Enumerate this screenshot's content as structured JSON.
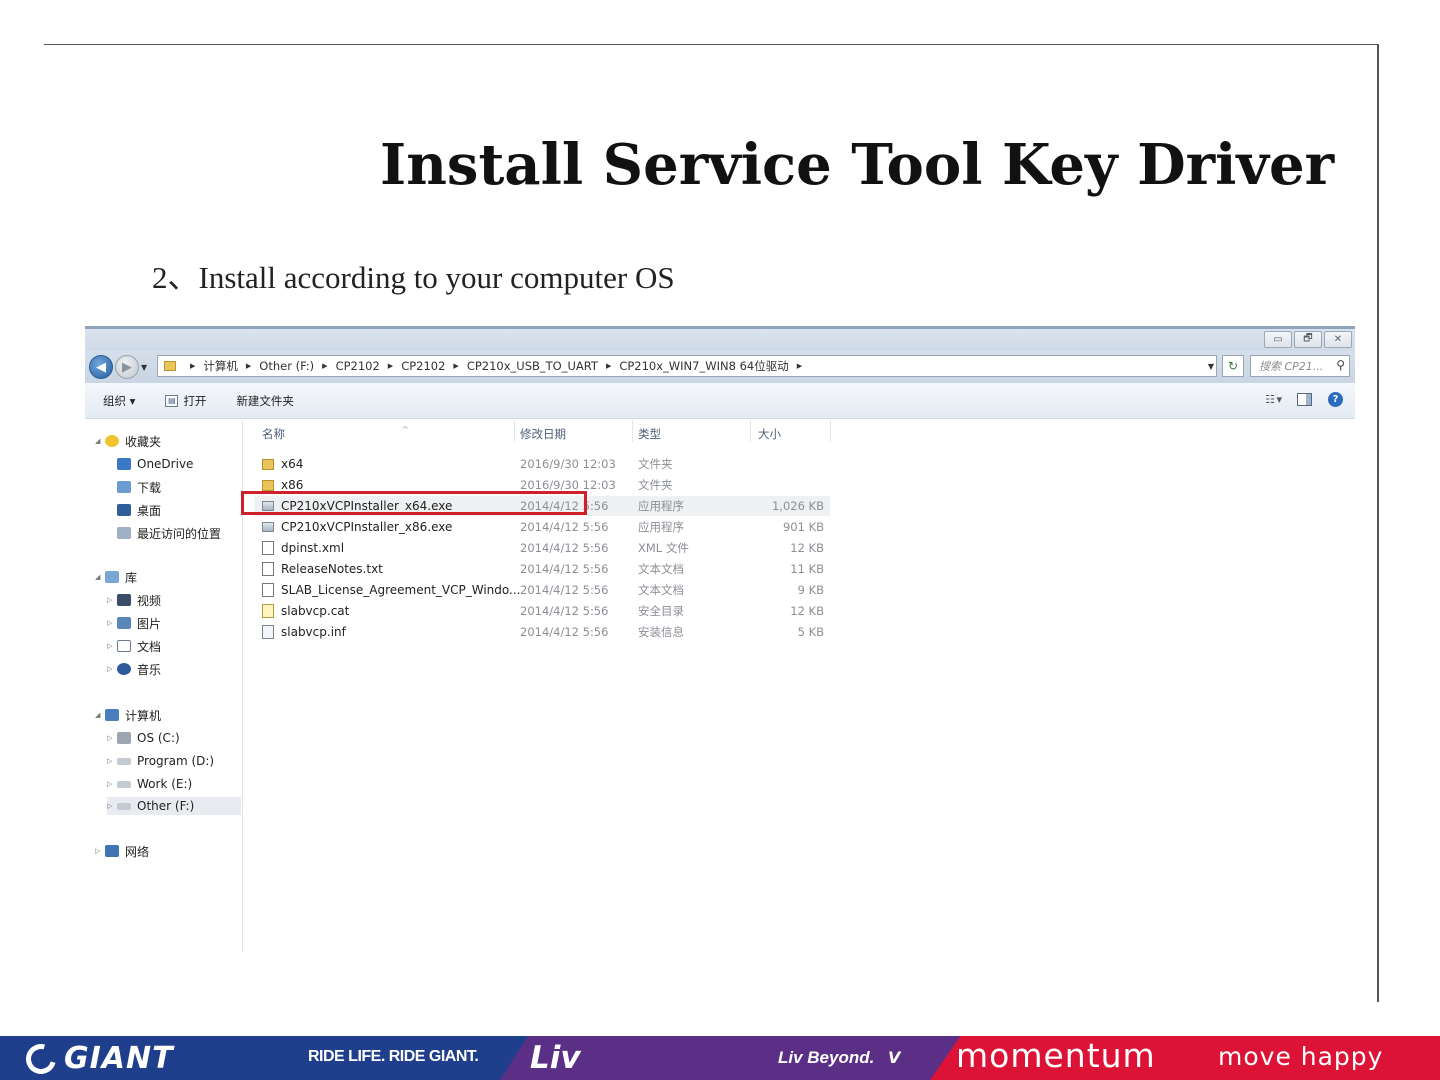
{
  "slide": {
    "title": "Install  Service Tool Key Driver",
    "subtitle": "2、Install according to your  computer OS"
  },
  "explorer": {
    "window_buttons": {
      "minimize": "▭",
      "maximize": "🗗",
      "close": "✕"
    },
    "breadcrumbs": [
      "计算机",
      "Other (F:)",
      "CP2102",
      "CP2102",
      "CP210x_USB_TO_UART",
      "CP210x_WIN7_WIN8 64位驱动"
    ],
    "search_placeholder": "搜索 CP21...",
    "toolbar": {
      "organize": "组织 ▾",
      "open": "打开",
      "new_folder": "新建文件夹"
    },
    "nav": {
      "favorites": "收藏夹",
      "onedrive": "OneDrive",
      "downloads": "下载",
      "desktop": "桌面",
      "recent": "最近访问的位置",
      "libraries": "库",
      "videos": "视频",
      "pictures": "图片",
      "documents": "文档",
      "music": "音乐",
      "computer": "计算机",
      "drive_c": "OS (C:)",
      "drive_d": "Program (D:)",
      "drive_e": "Work (E:)",
      "drive_f": "Other (F:)",
      "network": "网络"
    },
    "columns": {
      "name": "名称",
      "date": "修改日期",
      "type": "类型",
      "size": "大小"
    },
    "files": [
      {
        "name": "x64",
        "date": "2016/9/30 12:03",
        "type": "文件夹",
        "size": "",
        "icon": "folder-icon"
      },
      {
        "name": "x86",
        "date": "2016/9/30 12:03",
        "type": "文件夹",
        "size": "",
        "icon": "folder-icon"
      },
      {
        "name": "CP210xVCPInstaller_x64.exe",
        "date": "2014/4/12 5:56",
        "type": "应用程序",
        "size": "1,026 KB",
        "icon": "installer-icon"
      },
      {
        "name": "CP210xVCPInstaller_x86.exe",
        "date": "2014/4/12 5:56",
        "type": "应用程序",
        "size": "901 KB",
        "icon": "installer-icon"
      },
      {
        "name": "dpinst.xml",
        "date": "2014/4/12 5:56",
        "type": "XML 文件",
        "size": "12 KB",
        "icon": "document-icon"
      },
      {
        "name": "ReleaseNotes.txt",
        "date": "2014/4/12 5:56",
        "type": "文本文档",
        "size": "11 KB",
        "icon": "document-icon"
      },
      {
        "name": "SLAB_License_Agreement_VCP_Windo...",
        "date": "2014/4/12 5:56",
        "type": "文本文档",
        "size": "9 KB",
        "icon": "document-icon"
      },
      {
        "name": "slabvcp.cat",
        "date": "2014/4/12 5:56",
        "type": "安全目录",
        "size": "12 KB",
        "icon": "catalog-icon"
      },
      {
        "name": "slabvcp.inf",
        "date": "2014/4/12 5:56",
        "type": "安装信息",
        "size": "5 KB",
        "icon": "setup-info-icon"
      }
    ]
  },
  "footer": {
    "giant_brand": "GIANT",
    "giant_tagline": "RIDE LIFE. RIDE GIANT.",
    "liv_brand": "Liv",
    "liv_tagline": "Liv Beyond.",
    "momentum_brand": "momentum",
    "momentum_tagline": "move happy"
  },
  "colors": {
    "highlight_box": "#d0202a",
    "giant_blue": "#1f3f8c",
    "liv_purple": "#5c2f86",
    "momentum_red": "#dc1236"
  }
}
